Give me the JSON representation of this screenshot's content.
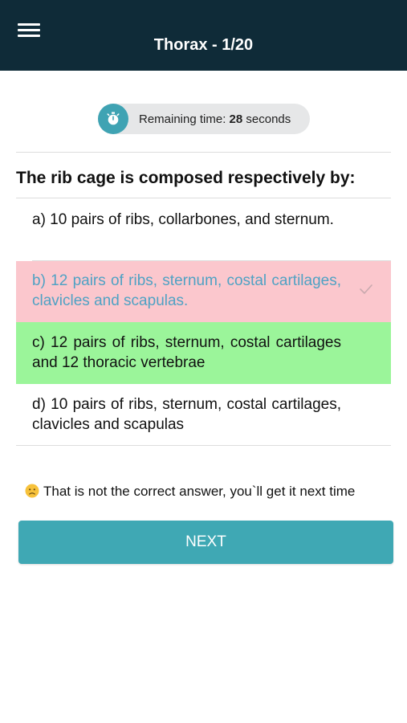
{
  "header": {
    "title": "Thorax - 1/20",
    "menu_icon": "hamburger-menu-icon",
    "background": "#0f2b38"
  },
  "timer": {
    "label": "Remaining time: ",
    "seconds": "28",
    "unit": " seconds",
    "icon": "stopwatch-icon",
    "accent": "#3fa3b3"
  },
  "question": {
    "text": "The rib cage is composed respectively by:"
  },
  "options": [
    {
      "text": "a) 10 pairs of ribs, collarbones, and sternum.",
      "state": "neutral"
    },
    {
      "text": "b) 12 pairs of ribs, sternum, costal cartilages, clavicles and scapulas.",
      "state": "selected-wrong",
      "color": "#fbc7cd"
    },
    {
      "text": "c) 12 pairs of ribs, sternum, costal cartilages and 12 thoracic vertebrae",
      "state": "correct",
      "color": "#9bf59a"
    },
    {
      "text": "d) 10 pairs of ribs, sternum, costal cartilages, clavicles and scapulas",
      "state": "neutral"
    }
  ],
  "feedback": {
    "text": "That is not the correct answer, you`ll get it next time",
    "icon": "sad-face-emoji-icon"
  },
  "next_button": {
    "label": "NEXT",
    "color": "#3fa8b4"
  }
}
